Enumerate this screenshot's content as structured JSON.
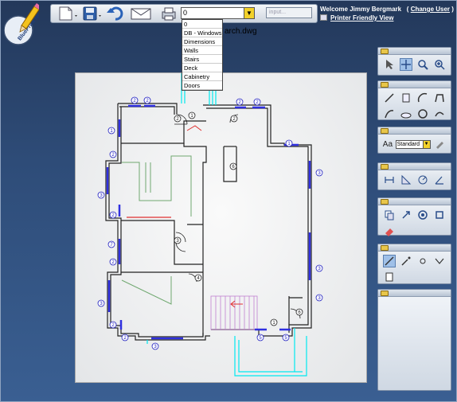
{
  "app": {
    "logo_text": "BluePrint Now",
    "file_name": "arch.dwg"
  },
  "toolbar": {
    "icons": [
      "new-file-icon",
      "save-icon",
      "undo-icon",
      "email-icon",
      "print-icon"
    ],
    "layer_value": "0",
    "input_placeholder": "input..."
  },
  "layer_dropdown": {
    "options": [
      "0",
      "DB - Windows",
      "Dimensions",
      "Walls",
      "Stairs",
      "Deck",
      "Cabinetry",
      "Doors"
    ]
  },
  "user": {
    "welcome": "Welcome Jimmy Bergmark",
    "change_user": "Change User",
    "printer_friendly": "Printer Friendly View"
  },
  "panels": {
    "text_style_value": "Standard",
    "text_label": "Aa"
  },
  "plan_labels": {
    "window_tags": [
      "2",
      "2",
      "2",
      "2",
      "1",
      "2",
      "3",
      "2",
      "7",
      "2",
      "3",
      "2",
      "2",
      "3",
      "5",
      "5",
      "3",
      "3",
      "3",
      "1"
    ],
    "door_tags": [
      "1",
      "2",
      "2",
      "6",
      "3",
      "4",
      "6",
      "1"
    ]
  },
  "colors": {
    "walls": "#000000",
    "windows": "#3030e0",
    "cyan_lines": "#00e8f0",
    "red_lines": "#e03030",
    "stairs": "#c080d0",
    "green": "#70a870"
  }
}
